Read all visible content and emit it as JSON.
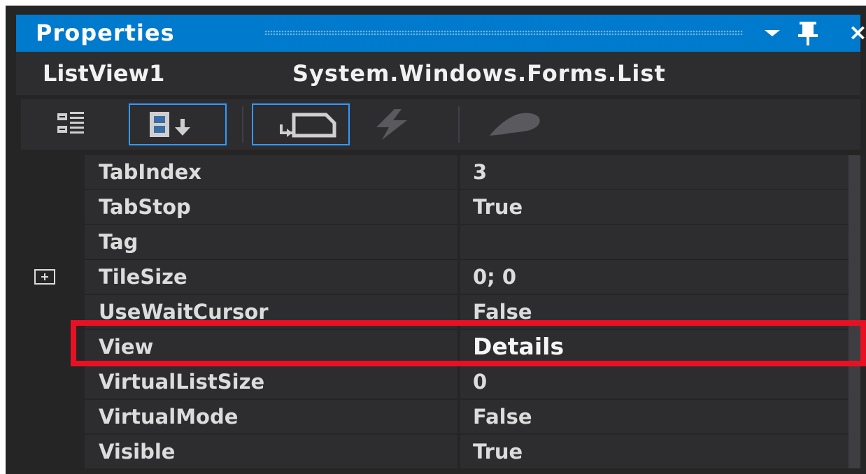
{
  "panel": {
    "title": "Properties",
    "object_name": "ListView1",
    "object_type": "System.Windows.Forms.List"
  },
  "toolbar": {
    "buttons": [
      {
        "icon": "categorized-icon",
        "active": false
      },
      {
        "icon": "alphabetical-icon",
        "active": true
      },
      {
        "icon": "properties-icon",
        "active": true
      },
      {
        "icon": "events-icon",
        "active": false
      },
      {
        "icon": "property-pages-icon",
        "active": false
      }
    ]
  },
  "properties": [
    {
      "name": "TabIndex",
      "value": "3",
      "expandable": false
    },
    {
      "name": "TabStop",
      "value": "True",
      "expandable": false
    },
    {
      "name": "Tag",
      "value": "",
      "expandable": false
    },
    {
      "name": "TileSize",
      "value": "0; 0",
      "expandable": true
    },
    {
      "name": "UseWaitCursor",
      "value": "False",
      "expandable": false
    },
    {
      "name": "View",
      "value": "Details",
      "expandable": false,
      "highlighted": true
    },
    {
      "name": "VirtualListSize",
      "value": "0",
      "expandable": false
    },
    {
      "name": "VirtualMode",
      "value": "False",
      "expandable": false
    },
    {
      "name": "Visible",
      "value": "True",
      "expandable": false
    }
  ],
  "colors": {
    "title_bar": "#007acc",
    "highlight_border": "#e81123",
    "active_button_border": "#3399ff"
  }
}
